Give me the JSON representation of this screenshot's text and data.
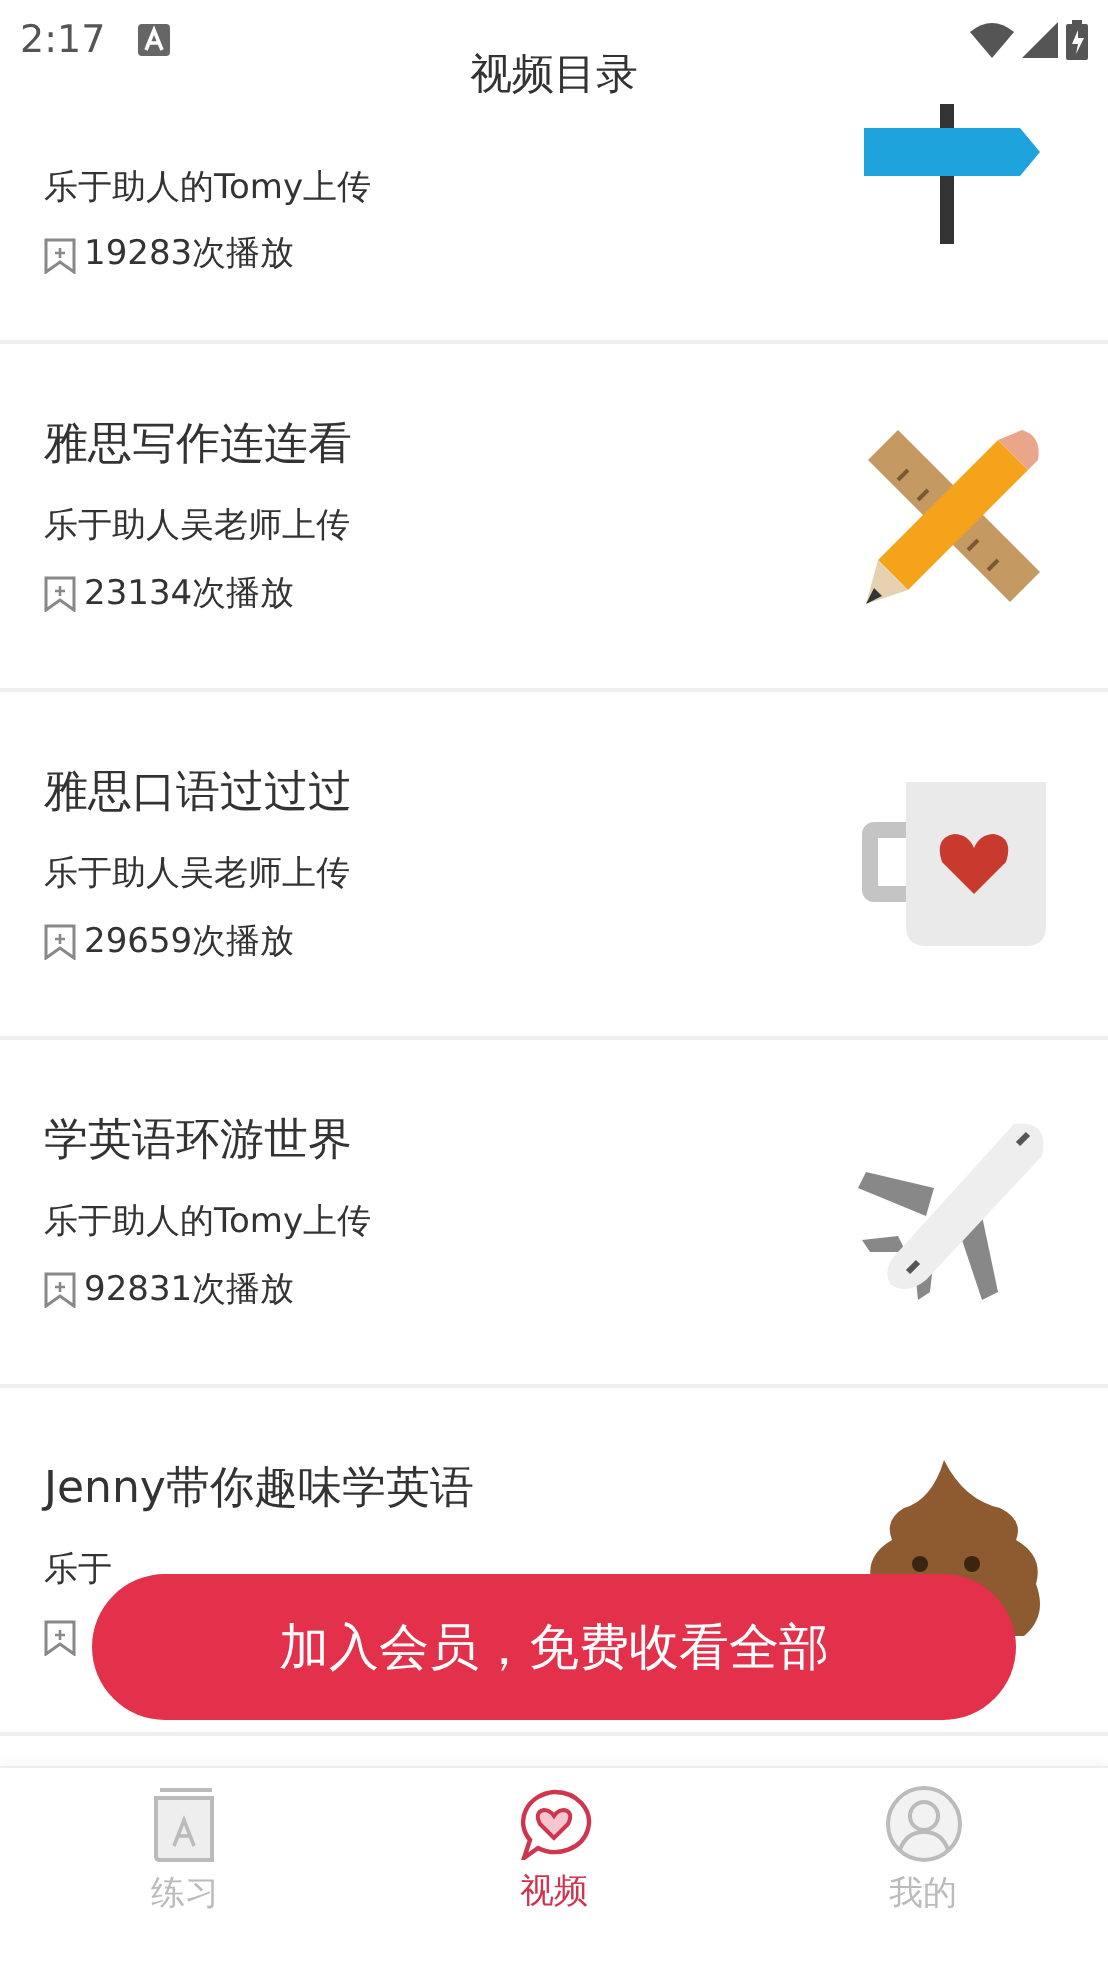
{
  "status_bar": {
    "time": "2:17"
  },
  "header": {
    "title": "视频目录"
  },
  "videos": [
    {
      "uploader": "乐于助人的Tomy上传",
      "plays": "19283次播放",
      "kind": "signpost"
    },
    {
      "title": "雅思写作连连看",
      "uploader": "乐于助人吴老师上传",
      "plays": "23134次播放",
      "kind": "pencil"
    },
    {
      "title": "雅思口语过过过",
      "uploader": "乐于助人吴老师上传",
      "plays": "29659次播放",
      "kind": "mug"
    },
    {
      "title": "学英语环游世界",
      "uploader": "乐于助人的Tomy上传",
      "plays": "92831次播放",
      "kind": "plane"
    },
    {
      "title": "Jenny带你趣味学英语",
      "uploader": "乐于",
      "kind": "poop"
    }
  ],
  "banner": {
    "label": "加入会员，免费收看全部"
  },
  "bottom_nav": [
    {
      "label": "练习",
      "kind": "book",
      "selected": false
    },
    {
      "label": "视频",
      "kind": "heart",
      "selected": true
    },
    {
      "label": "我的",
      "kind": "person",
      "selected": false
    }
  ]
}
